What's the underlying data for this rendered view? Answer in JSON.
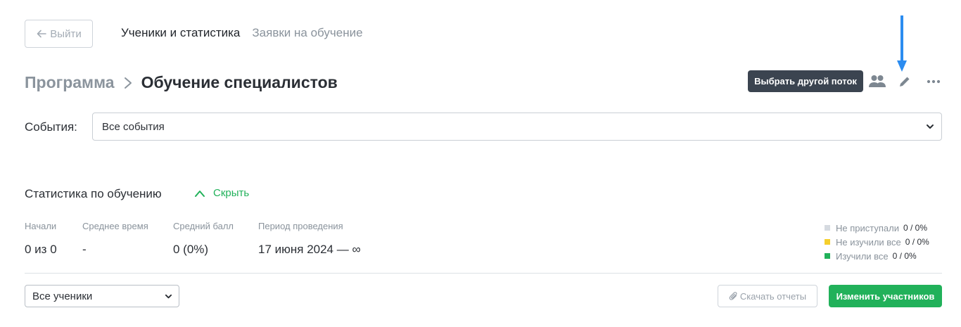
{
  "header": {
    "back_label": "Выйти",
    "tabs": [
      {
        "label": "Ученики и статистика",
        "active": true
      },
      {
        "label": "Заявки на обучение",
        "active": false
      }
    ]
  },
  "breadcrumb": {
    "parent": "Программа",
    "current": "Обучение специалистов"
  },
  "toolbar": {
    "tooltip": "Выбрать другой поток",
    "icons": [
      "users-icon",
      "pencil-icon",
      "more-icon"
    ]
  },
  "events": {
    "label": "События:",
    "selected": "Все события"
  },
  "stats": {
    "title": "Статистика по обучению",
    "toggle_label": "Скрыть",
    "columns": [
      {
        "label": "Начали",
        "value": "0 из 0"
      },
      {
        "label": "Среднее время",
        "value": "-"
      },
      {
        "label": "Средний балл",
        "value": "0 (0%)"
      },
      {
        "label": "Период проведения",
        "value": "17 июня 2024 — ∞"
      }
    ],
    "legend": [
      {
        "label": "Не приступали",
        "value": "0 / 0%",
        "color": "#d5dae0"
      },
      {
        "label": "Не изучили все",
        "value": "0 / 0%",
        "color": "#f5cf2c"
      },
      {
        "label": "Изучили все",
        "value": "0 / 0%",
        "color": "#21b15a"
      }
    ]
  },
  "footer": {
    "students_select": "Все ученики",
    "download_label": "Скачать отчеты",
    "change_label": "Изменить участников"
  },
  "colors": {
    "accent_green": "#21b15a",
    "tooltip_bg": "#3b4450",
    "arrow_blue": "#2b8cf0"
  }
}
